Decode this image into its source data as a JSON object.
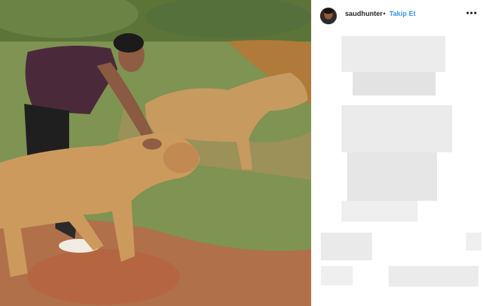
{
  "post": {
    "username": "saudhunter",
    "separator": "•",
    "follow_label": "Takip Et",
    "more_icon": "more-options-icon"
  },
  "colors": {
    "follow": "#3897f0",
    "text": "#262626",
    "blur": "#e9e9e9"
  }
}
